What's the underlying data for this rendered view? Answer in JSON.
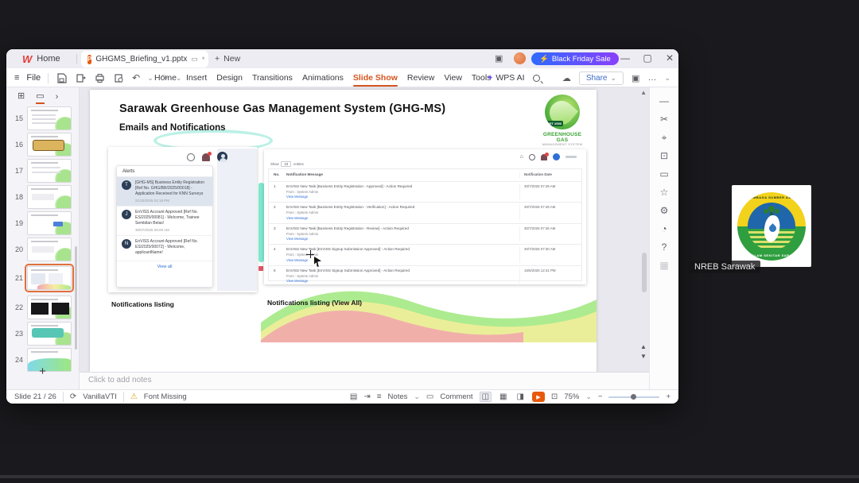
{
  "colors": {
    "accent_orange": "#d4551f",
    "promo_from": "#2e6bff",
    "promo_to": "#8a3ffc",
    "teal": "#7de8cf",
    "link_blue": "#2f6fd6",
    "play_orange": "#e8590c",
    "logo_green": "#3aa235"
  },
  "icons": {
    "wps_logo": "W",
    "pptx": "P",
    "monitor": "▭",
    "modified": "*",
    "plus": "+",
    "stack": "▣",
    "minimize": "—",
    "maximize": "▢",
    "close": "✕",
    "hamburger": "≡",
    "undo": "↶",
    "redo": "↷",
    "chevron_down": "⌄",
    "chevron_right": "›",
    "cloud": "☁",
    "sparkle": "✦",
    "lightning": "⚡",
    "outline_view": "⊞",
    "slide_view": "▭",
    "warning": "⚠",
    "theme": "⟳",
    "page": "▤",
    "export_note": "⇥",
    "notes_lines": "≡",
    "comment_box": "▭",
    "view_normal": "◫",
    "view_sorter": "▦",
    "view_read": "◨",
    "play": "▶",
    "fullscreen": "⊡",
    "minus": "−",
    "dots": "…",
    "scroll_up": "▲",
    "page_prev": "▲",
    "page_next": "▼",
    "home_mini": "⌂"
  },
  "tabbar": {
    "home": "Home",
    "doc": "GHGMS_Briefing_v1.pptx",
    "new": "New",
    "promo": "Black Friday Sale"
  },
  "toolbar": {
    "file": "File",
    "share": "Share",
    "wps_ai": "WPS AI",
    "menus": [
      {
        "label": "Home"
      },
      {
        "label": "Insert"
      },
      {
        "label": "Design"
      },
      {
        "label": "Transitions"
      },
      {
        "label": "Animations"
      },
      {
        "label": "Slide Show",
        "state": "active"
      },
      {
        "label": "Review"
      },
      {
        "label": "View"
      },
      {
        "label": "Tools"
      }
    ]
  },
  "slide_panel": {
    "slides": [
      {
        "num": "15",
        "variant": "v-list"
      },
      {
        "num": "16",
        "variant": "v-gold"
      },
      {
        "num": "17",
        "variant": "v-lines"
      },
      {
        "num": "18",
        "variant": "v-plain"
      },
      {
        "num": "19",
        "variant": "v-blue"
      },
      {
        "num": "20",
        "variant": "v-plain"
      },
      {
        "num": "21",
        "variant": "v-current",
        "state": "sel"
      },
      {
        "num": "22",
        "variant": "v-dark"
      },
      {
        "num": "23",
        "variant": "v-teal"
      },
      {
        "num": "24",
        "variant": "v-wave"
      }
    ],
    "add_label": "+"
  },
  "slide": {
    "title": "Sarawak Greenhouse Gas Management System (GHG-MS)",
    "subtitle": "Emails and Notifications",
    "logo": {
      "badge": "NET 2050",
      "line1": "GREENHOUSE GAS",
      "line2": "MANAGEMENT SYSTEM"
    },
    "captions": {
      "left": "Notifications listing",
      "right": "Notifications listing (View All)"
    },
    "alerts": {
      "title": "Alerts",
      "view_all": "View all",
      "items": [
        {
          "initial": "T",
          "text": "[GHG-MS] Business Entity Registration [Ref No. GHG/BR/2025/00018] - Application Received for KNN Surveys",
          "time": "21/10/2025 02:19 PM",
          "state": "hl"
        },
        {
          "initial": "J",
          "text": "EnVISS Account Approved [Ref No. ES/2025/00081] - Welcome, Trainee Sembilan Belas!",
          "time": "30/07/2025 09:09 AM"
        },
        {
          "initial": "N",
          "text": "EnVISS Account Approved [Ref No. ES/2025/00072] - Welcome, applicantName!",
          "time": ""
        }
      ]
    },
    "table": {
      "show": "Show",
      "page_size": "10",
      "entries": "entries",
      "headers": {
        "no": "No.",
        "message": "Notification Message",
        "date": "Notification Date"
      },
      "rows": [
        {
          "no": "1",
          "msg": "EnVISS New Task [Business Entity Registration - Approved] - Action Required",
          "from": "From : System Admin",
          "link": "View Message",
          "date": "30/7/2025 07:49 AM"
        },
        {
          "no": "2",
          "msg": "EnVISS New Task [Business Entity Registration - Verification] - Action Required",
          "from": "From : System Admin",
          "link": "View Message",
          "date": "30/7/2025 07:49 AM"
        },
        {
          "no": "3",
          "msg": "EnVISS New Task [Business Entity Registration - Review] - Action Required",
          "from": "From : System Admin",
          "link": "View Message",
          "date": "30/7/2025 07:46 AM"
        },
        {
          "no": "4",
          "msg": "EnVISS New Task [EnVISS Signup Submission Approved] - Action Required",
          "from": "From : System Admin",
          "link": "View Message",
          "date": "30/7/2025 07:30 AM"
        },
        {
          "no": "5",
          "msg": "EnVISS New Task [EnVISS Signup Submission Approved] - Action Required",
          "from": "From : System Admin",
          "link": "View Message",
          "date": "16/6/2025 12:41 PM"
        }
      ]
    }
  },
  "notes": {
    "placeholder": "Click to add notes"
  },
  "statusbar": {
    "slide_info": "Slide 21 / 26",
    "theme": "VanillaVTI",
    "font_missing": "Font Missing",
    "notes": "Notes",
    "comment": "Comment",
    "zoom": "75%"
  },
  "sidebar_icons": [
    {
      "name": "collapse-icon",
      "glyph": "—"
    },
    {
      "name": "design-tools-icon",
      "glyph": "✂"
    },
    {
      "name": "ai-style-icon",
      "glyph": "⌖"
    },
    {
      "name": "shapes-icon",
      "glyph": "⊡"
    },
    {
      "name": "comment-icon",
      "glyph": "▭"
    },
    {
      "name": "favorites-icon",
      "glyph": "☆"
    },
    {
      "name": "settings-icon",
      "glyph": "⚙"
    },
    {
      "name": "history-icon",
      "glyph": "◔"
    },
    {
      "name": "help-icon",
      "glyph": "?"
    },
    {
      "name": "apps-icon",
      "glyph": "▦"
    }
  ],
  "overlay": {
    "participant": "NREB Sarawak",
    "logo_top": "LEMBAGA SUMBER ASLI",
    "logo_bottom": "DAN ALAM SEKITAR SARAWAK"
  }
}
